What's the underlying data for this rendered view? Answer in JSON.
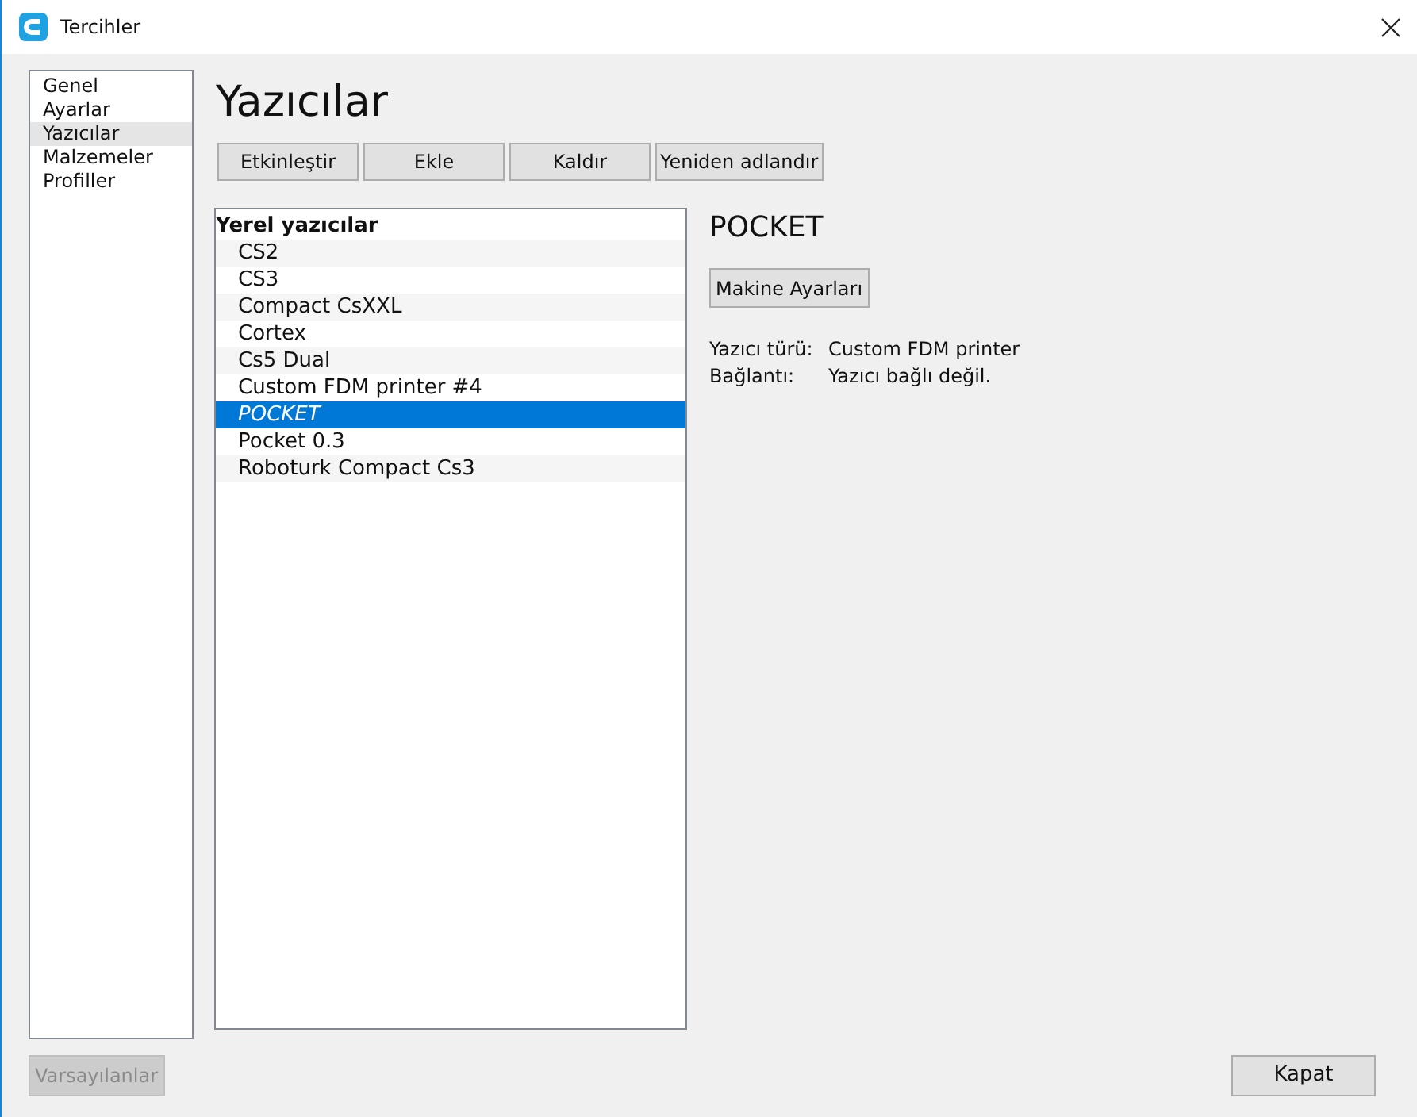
{
  "window": {
    "title": "Tercihler"
  },
  "sidebar": {
    "items": [
      {
        "label": "Genel",
        "selected": false
      },
      {
        "label": "Ayarlar",
        "selected": false
      },
      {
        "label": "Yazıcılar",
        "selected": true
      },
      {
        "label": "Malzemeler",
        "selected": false
      },
      {
        "label": "Profiller",
        "selected": false
      }
    ]
  },
  "heading": "Yazıcılar",
  "toolbar": [
    {
      "label": "Etkinleştir"
    },
    {
      "label": "Ekle"
    },
    {
      "label": "Kaldır"
    },
    {
      "label": "Yeniden adlandır"
    }
  ],
  "printer_list": {
    "group": "Yerel yazıcılar",
    "items": [
      {
        "label": "CS2",
        "selected": false,
        "active": false
      },
      {
        "label": "CS3",
        "selected": false,
        "active": false
      },
      {
        "label": "Compact CsXXL",
        "selected": false,
        "active": false
      },
      {
        "label": "Cortex",
        "selected": false,
        "active": false
      },
      {
        "label": "Cs5 Dual",
        "selected": false,
        "active": false
      },
      {
        "label": "Custom FDM printer #4",
        "selected": false,
        "active": false
      },
      {
        "label": "POCKET",
        "selected": true,
        "active": true
      },
      {
        "label": "Pocket 0.3",
        "selected": false,
        "active": false
      },
      {
        "label": "Roboturk Compact Cs3",
        "selected": false,
        "active": false
      }
    ]
  },
  "details": {
    "name": "POCKET",
    "settings_button": "Makine Ayarları",
    "info": [
      {
        "label": "Yazıcı türü:",
        "value": "Custom FDM printer"
      },
      {
        "label": "Bağlantı:",
        "value": "Yazıcı bağlı değil."
      }
    ]
  },
  "footer": {
    "defaults_button": {
      "label": "Varsayılanlar",
      "disabled": true
    },
    "close_button": {
      "label": "Kapat",
      "disabled": false
    }
  }
}
